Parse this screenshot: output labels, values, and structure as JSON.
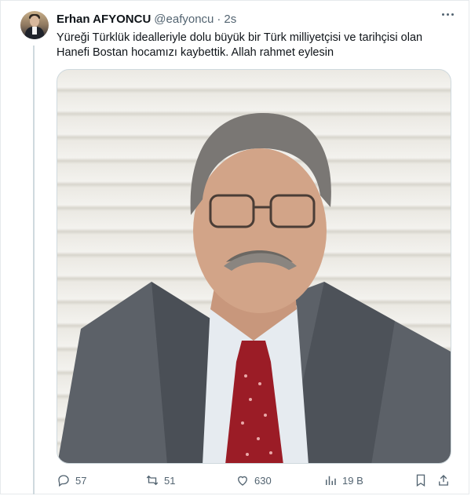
{
  "tweet": {
    "author_name": "Erhan AFYONCU",
    "handle": "@eafyoncu",
    "separator": "·",
    "time": "2s",
    "text": "Yüreği Türklük idealleriyle dolu büyük bir Türk milliyetçisi ve tarihçisi olan Hanefi Bostan hocamızı kaybettik. Allah rahmet eylesin"
  },
  "actions": {
    "replies": "57",
    "retweets": "51",
    "likes": "630",
    "views": "19 B"
  },
  "icons": {
    "reply": "reply-icon",
    "retweet": "retweet-icon",
    "like": "heart-icon",
    "views": "analytics-icon",
    "bookmark": "bookmark-icon",
    "share": "share-icon",
    "more": "more-icon"
  },
  "colors": {
    "text": "#0f1419",
    "muted": "#536471",
    "border": "#cfd9de"
  }
}
